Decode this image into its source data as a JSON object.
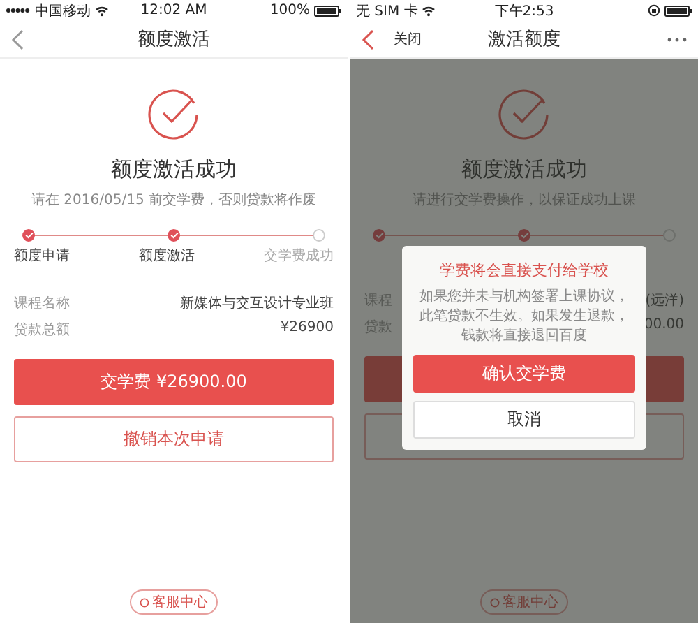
{
  "screens": [
    {
      "status_bar": {
        "signal": true,
        "carrier": "中国移动",
        "time": "12:02 AM",
        "battery": "100%",
        "locked": false
      },
      "nav": {
        "title": "额度激活",
        "more": false
      },
      "result": {
        "title": "额度激活成功",
        "subtitle": "请在 2016/05/15 前交学费，否则贷款将作废"
      },
      "steps": [
        {
          "label": "额度申请",
          "done": true
        },
        {
          "label": "额度激活",
          "done": true
        },
        {
          "label": "交学费成功",
          "done": false
        }
      ],
      "details": [
        {
          "label": "课程名称",
          "value": "新媒体与交互设计专业班"
        },
        {
          "label": "贷款总额",
          "value": "¥26900"
        }
      ],
      "buttons": [
        {
          "label": "交学费  ¥26900.00",
          "kind": "primary"
        },
        {
          "label": "撤销本次申请",
          "kind": "outline"
        }
      ],
      "service_link": "客服中心"
    },
    {
      "status_bar": {
        "signal": false,
        "carrier": "无 SIM 卡",
        "time": "下午2:53",
        "locked": true
      },
      "nav": {
        "close_label": "关闭",
        "title": "激活额度",
        "more": true
      },
      "result": {
        "title": "额度激活成功",
        "subtitle": "请进行交学费操作，以保证成功上课"
      },
      "steps": [
        {
          "done": true
        },
        {
          "done": true
        },
        {
          "done": false
        }
      ],
      "details": [
        {
          "label": "课程",
          "value": "(远洋)"
        },
        {
          "label": "贷款",
          "value": "00.00"
        }
      ],
      "buttons": [
        {
          "kind": "primary"
        },
        {
          "kind": "outline"
        }
      ],
      "service_link": "客服中心",
      "dialog": {
        "title": "学费将会直接支付给学校",
        "message": "如果您并未与机构签署上课协议，此笔贷款不生效。如果发生退款，钱款将直接退回百度",
        "buttons": [
          {
            "label": "确认交学费",
            "kind": "primary"
          },
          {
            "label": "取消",
            "kind": "secondary"
          }
        ]
      }
    }
  ]
}
